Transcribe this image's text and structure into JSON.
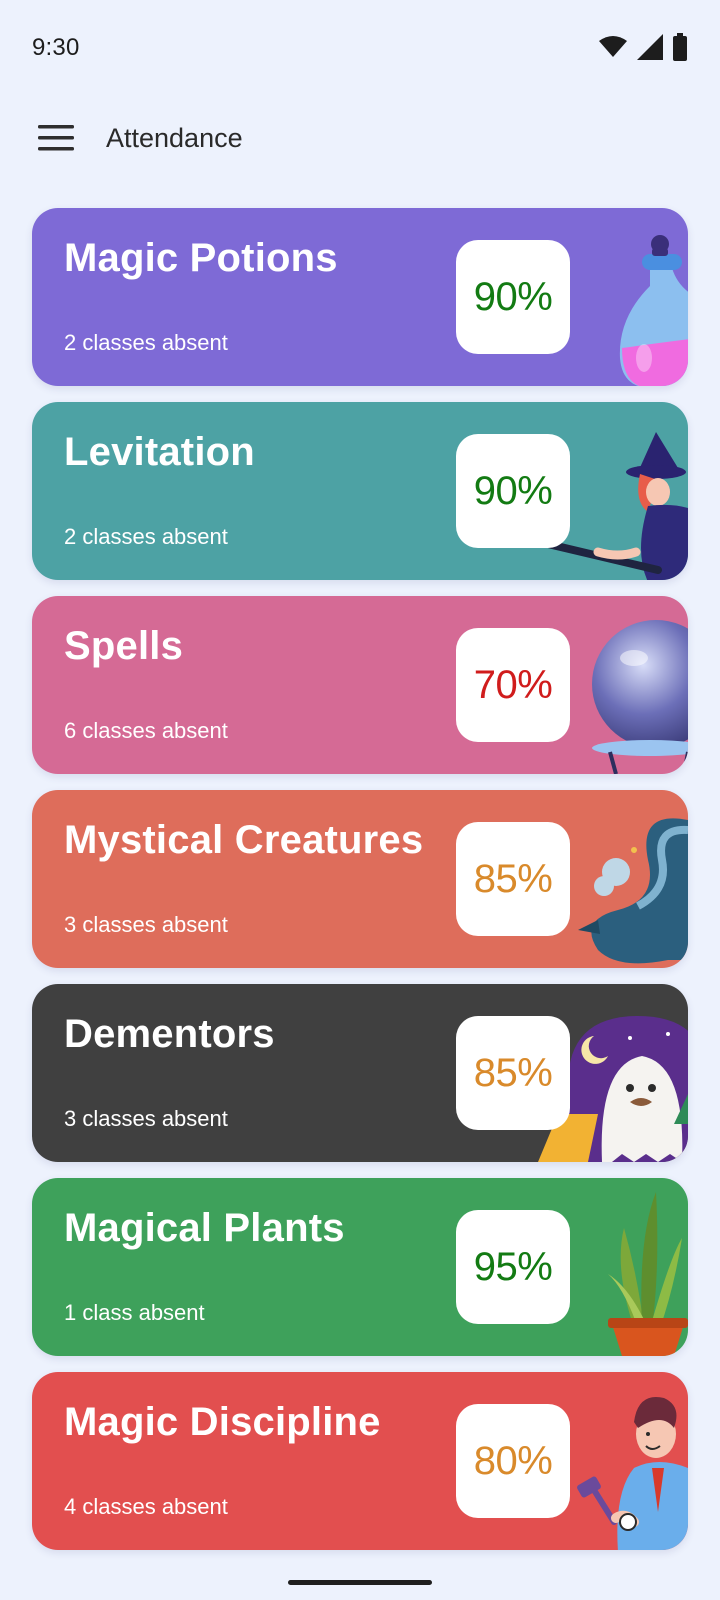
{
  "status_bar": {
    "time": "9:30",
    "icons": [
      "wifi-icon",
      "cellular-signal-icon",
      "battery-icon"
    ]
  },
  "app_bar": {
    "menu_icon": "hamburger-menu-icon",
    "title": "Attendance"
  },
  "colors": {
    "background": "#EDF2FD",
    "good": "#137B13",
    "warning": "#D98A2B",
    "bad": "#D01C1C"
  },
  "subjects": [
    {
      "name": "Magic Potions",
      "percent": "90%",
      "absent": "2 classes absent",
      "card_color": "#7E6AD6",
      "percent_color": "#137B13",
      "illustration": "potion-flask-icon"
    },
    {
      "name": "Levitation",
      "percent": "90%",
      "absent": "2 classes absent",
      "card_color": "#4DA2A4",
      "percent_color": "#137B13",
      "illustration": "witch-on-broom-icon"
    },
    {
      "name": "Spells",
      "percent": "70%",
      "absent": "6 classes absent",
      "card_color": "#D56A95",
      "percent_color": "#D01C1C",
      "illustration": "crystal-ball-icon"
    },
    {
      "name": "Mystical Creatures",
      "percent": "85%",
      "absent": "3 classes absent",
      "card_color": "#DE6D5B",
      "percent_color": "#D98A2B",
      "illustration": "dragon-icon"
    },
    {
      "name": "Dementors",
      "percent": "85%",
      "absent": "3 classes absent",
      "card_color": "#404040",
      "percent_color": "#D98A2B",
      "illustration": "ghost-icon"
    },
    {
      "name": "Magical Plants",
      "percent": "95%",
      "absent": "1 class absent",
      "card_color": "#3EA15B",
      "percent_color": "#137B13",
      "illustration": "potted-plant-icon"
    },
    {
      "name": "Magic Discipline",
      "percent": "80%",
      "absent": "4 classes absent",
      "card_color": "#E24F4F",
      "percent_color": "#D98A2B",
      "illustration": "judge-with-gavel-icon"
    }
  ]
}
